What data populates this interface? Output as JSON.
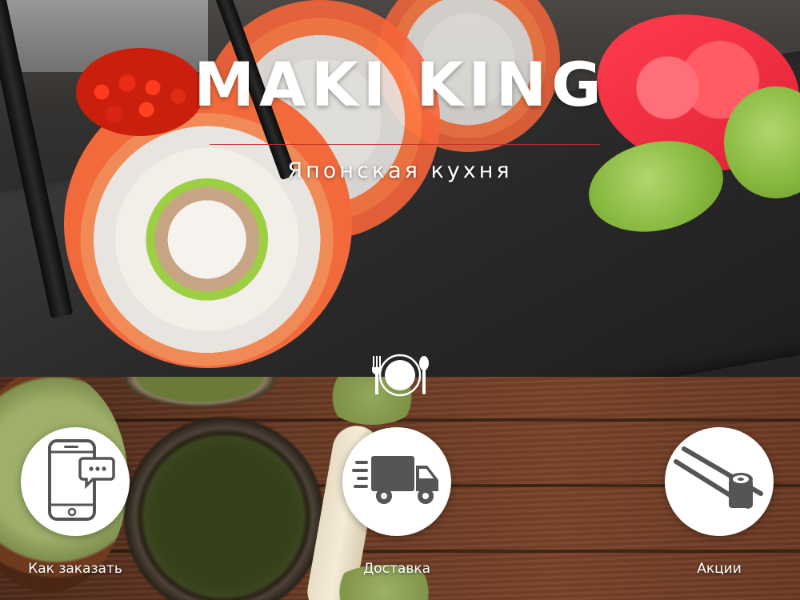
{
  "hero": {
    "title": "MAKI KING",
    "subtitle": "Японская кухня"
  },
  "features": [
    {
      "label": "Как заказать",
      "icon": "phone-chat-icon"
    },
    {
      "label": "Доставка",
      "icon": "delivery-truck-icon"
    },
    {
      "label": "Акции",
      "icon": "sushi-chopsticks-icon"
    }
  ],
  "divider_icon": "plate-cutlery-icon",
  "colors": {
    "accent_line": "#c92b2b",
    "icon_gray": "#555555",
    "circle_bg": "#ffffff",
    "text_white": "#ffffff"
  }
}
